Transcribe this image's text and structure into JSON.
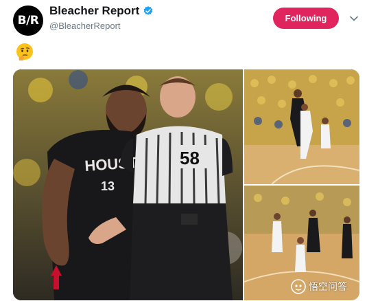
{
  "tweet": {
    "account_name": "Bleacher Report",
    "handle": "@BleacherReport",
    "avatar_text": "B/R",
    "follow_label": "Following",
    "emoji": "thinking-face",
    "colors": {
      "follow": "#e0245e",
      "verified": "#1da1f2",
      "name": "#14171a",
      "handle": "#657786"
    }
  },
  "media": {
    "main_photo": {
      "jersey_text": "HOUSTON",
      "jersey_number": "13",
      "referee_number": "58"
    },
    "watermark": "悟空问答"
  }
}
